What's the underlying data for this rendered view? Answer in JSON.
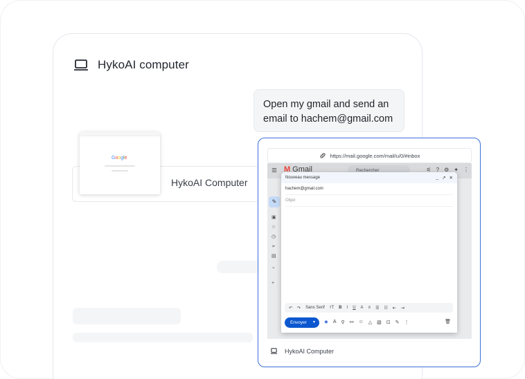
{
  "app": {
    "title": "HykoAI computer"
  },
  "chat": {
    "user_message": "Open my gmail and send an email to hachem@gmail.com"
  },
  "computer_row": {
    "label": "HykoAI Computer",
    "thumbnail_logo": "Google"
  },
  "browser": {
    "url": "https://mail.google.com/mail/u/0/#inbox"
  },
  "gmail": {
    "logo": "Gmail",
    "search_placeholder": "Rechercher",
    "compose": {
      "title": "Nouveau message",
      "controls": [
        "_",
        "↗",
        "✕"
      ],
      "to": "hachem@gmail.com",
      "subject_placeholder": "Objet",
      "font": "Sans Serif",
      "send_label": "Envoyer"
    }
  },
  "footer": {
    "label": "HykoAI Computer"
  },
  "icons": {
    "header": "laptop-icon",
    "url": "link-icon",
    "footer": "monitor-icon"
  }
}
